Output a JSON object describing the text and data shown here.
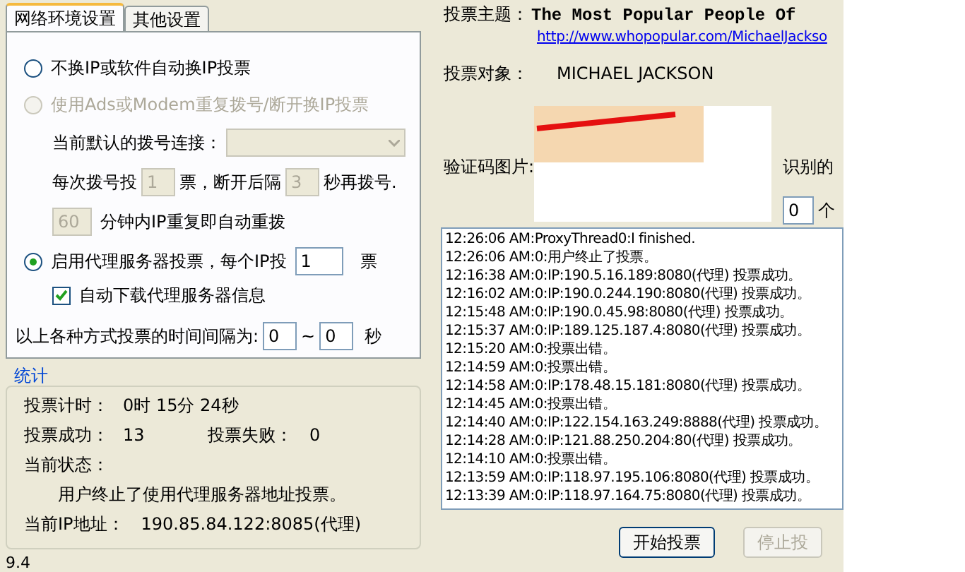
{
  "tabs": [
    {
      "label": "网络环境设置",
      "selected": true
    },
    {
      "label": "其他设置",
      "selected": false
    }
  ],
  "options": {
    "no_change": {
      "label": "不换IP或软件自动换IP投票",
      "selected": false,
      "disabled": false
    },
    "dialup": {
      "label": "使用Ads或Modem重复拨号/断开换IP投票",
      "selected": false,
      "disabled": true
    },
    "dial_connection_label": "当前默认的拨号连接：",
    "votes_per_dial_label": "每次拨号投",
    "votes_per_dial": "1",
    "after_disconnect_label": "票，断开后隔",
    "redial_seconds": "3",
    "redial_label": "秒再拨号.",
    "repeat_minutes": "60",
    "repeat_label": "分钟内IP重复即自动重拨",
    "proxy": {
      "label": "启用代理服务器投票，每个IP投",
      "selected": true,
      "disabled": false
    },
    "votes_per_ip": "1",
    "votes_unit": "票",
    "auto_download": {
      "label": "自动下载代理服务器信息",
      "checked": true
    },
    "interval_label": "以上各种方式投票的时间间隔为:",
    "interval_from": "0",
    "interval_sep": "~",
    "interval_to": "0",
    "interval_unit": "秒"
  },
  "stats": {
    "title": "统计",
    "timer_label": "投票计时：",
    "timer": "0时 15分 24秒",
    "success_label": "投票成功：",
    "success": "13",
    "fail_label": "投票失败：",
    "fail": "0",
    "status_label": "当前状态：",
    "status": "用户终止了使用代理服务器地址投票。",
    "ip_label": "当前IP地址：",
    "ip": "190.85.84.122:8085(代理)"
  },
  "version": "9.4",
  "vote": {
    "topic_label": "投票主题：",
    "topic": "The Most Popular People Of",
    "url": "http://www.whopopular.com/MichaelJackso",
    "target_label": "投票对象：",
    "target": "MICHAEL JACKSON",
    "captcha_label": "验证码图片:",
    "recognized_label": "识别的",
    "count": "0",
    "count_unit": "个"
  },
  "log": [
    "12:26:06 AM:ProxyThread0:I finished.",
    "12:26:06 AM:0:用户终止了投票。",
    "12:16:38 AM:0:IP:190.5.16.189:8080(代理) 投票成功。",
    "12:16:02 AM:0:IP:190.0.244.190:8080(代理) 投票成功。",
    "12:15:48 AM:0:IP:190.0.45.98:8080(代理) 投票成功。",
    "12:15:37 AM:0:IP:189.125.187.4:8080(代理) 投票成功。",
    "12:15:20 AM:0:投票出错。",
    "12:14:59 AM:0:投票出错。",
    "12:14:58 AM:0:IP:178.48.15.181:8080(代理) 投票成功。",
    "12:14:45 AM:0:投票出错。",
    "12:14:40 AM:0:IP:122.154.163.249:8888(代理) 投票成功。",
    "12:14:28 AM:0:IP:121.88.250.204:80(代理) 投票成功。",
    "12:14:10 AM:0:投票出错。",
    "12:13:59 AM:0:IP:118.97.195.106:8080(代理) 投票成功。",
    "12:13:39 AM:0:IP:118.97.164.75:8080(代理) 投票成功。"
  ],
  "buttons": [
    {
      "label": "开始投票",
      "disabled": false
    },
    {
      "label": "停止投",
      "disabled": true
    }
  ]
}
